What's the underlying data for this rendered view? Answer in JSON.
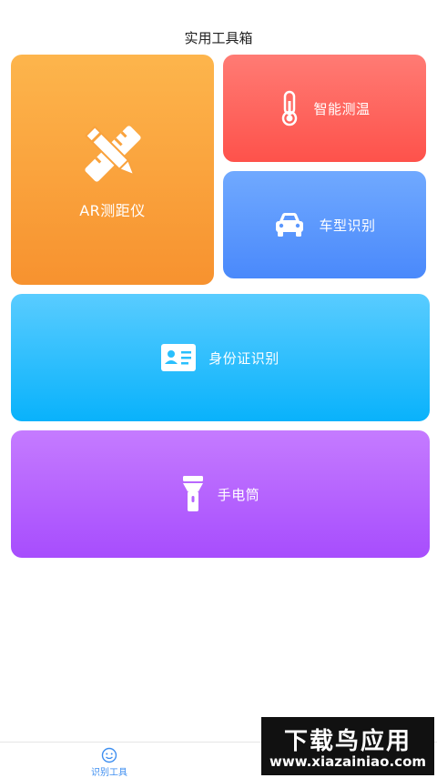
{
  "header": {
    "title": "实用工具箱"
  },
  "cards": {
    "ar": {
      "label": "AR测距仪",
      "icon": "pencil-ruler-icon"
    },
    "temperature": {
      "label": "智能测温",
      "icon": "thermometer-icon"
    },
    "car": {
      "label": "车型识别",
      "icon": "car-icon"
    },
    "idcard": {
      "label": "身份证识别",
      "icon": "id-card-icon"
    },
    "flashlight": {
      "label": "手电筒",
      "icon": "flashlight-icon"
    }
  },
  "tabbar": {
    "tab1": {
      "label": "识别工具",
      "icon": "face-scan-icon",
      "color": "#3d8ef0"
    }
  },
  "watermark": {
    "line1": "下载鸟应用",
    "line2": "www.xiazainiao.com"
  }
}
